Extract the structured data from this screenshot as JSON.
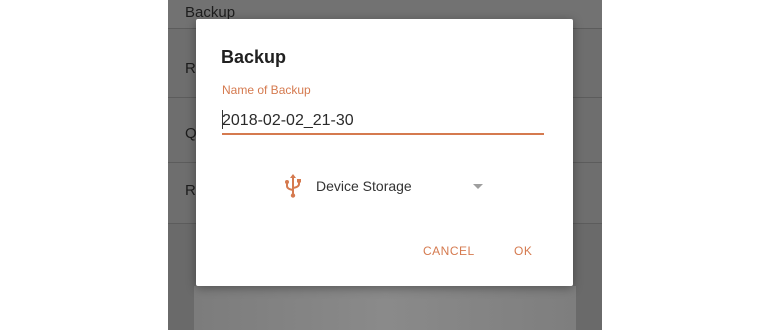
{
  "background_list": {
    "items": [
      "Backup",
      "Re",
      "Q",
      "Re"
    ]
  },
  "dialog": {
    "title": "Backup",
    "name_field": {
      "label": "Name of Backup",
      "value": "2018-02-02_21-30"
    },
    "storage": {
      "icon": "usb-icon",
      "selected": "Device Storage"
    },
    "cancel_label": "CANCEL",
    "ok_label": "OK"
  },
  "colors": {
    "accent": "#d57a4f",
    "scrim": "#6e6e6e"
  }
}
